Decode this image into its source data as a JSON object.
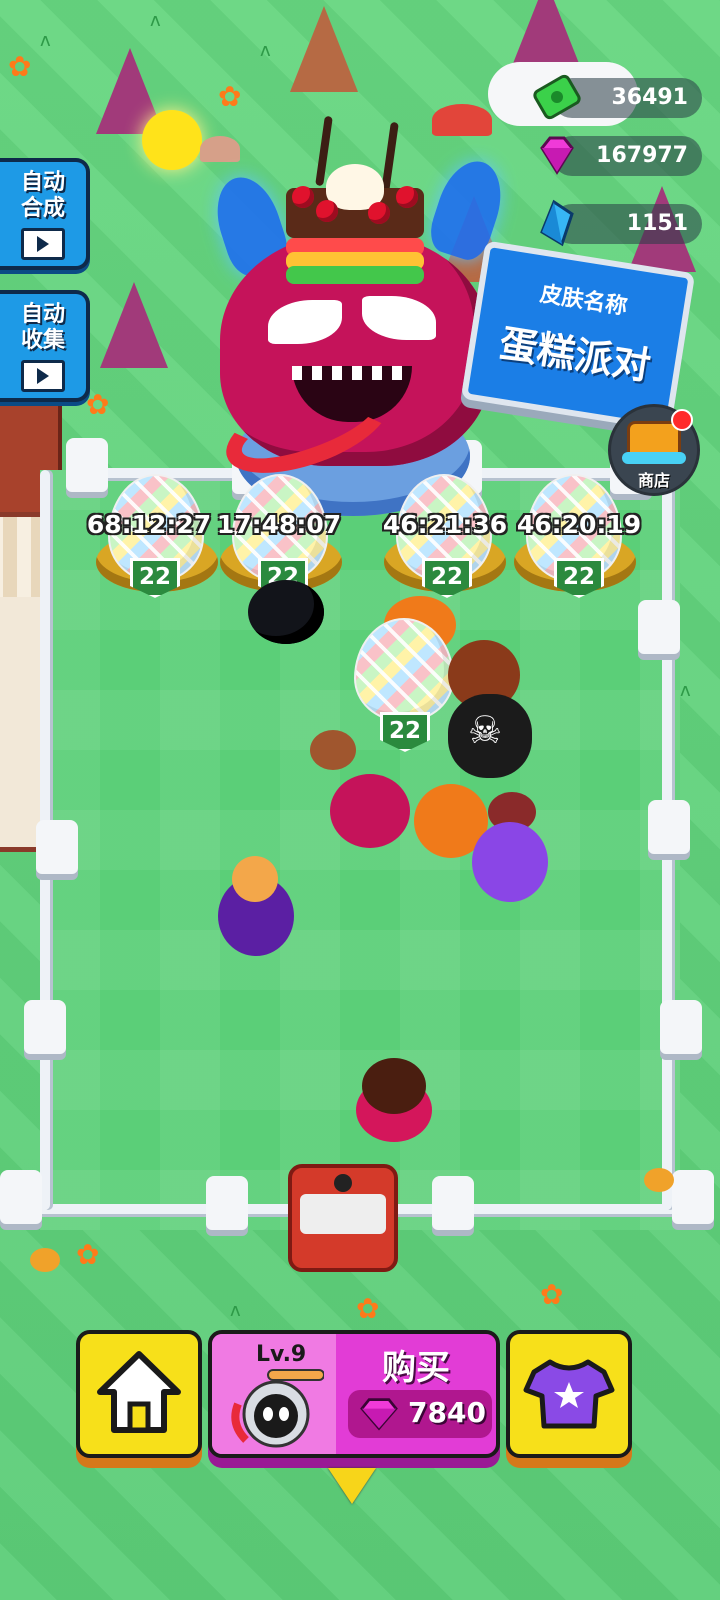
{
  "side_buttons": [
    {
      "label_line1": "自动",
      "label_line2": "合成",
      "icon": "video-icon"
    },
    {
      "label_line1": "自动",
      "label_line2": "收集",
      "icon": "video-icon"
    }
  ],
  "currencies": {
    "cash": {
      "value": "36491",
      "icon": "cash-icon",
      "color": "#3bd14a"
    },
    "gems": {
      "value": "167977",
      "icon": "pink-gem-icon",
      "color": "#f03ad8"
    },
    "diamonds": {
      "value": "1151",
      "icon": "blue-crystal-icon",
      "color": "#37b6f5"
    }
  },
  "billboard": {
    "subtitle": "皮肤名称",
    "title": "蛋糕派对"
  },
  "shop": {
    "label": "商店"
  },
  "eggs": [
    {
      "timer": "68:12:27",
      "level": "22"
    },
    {
      "timer": "17:48:07",
      "level": "22"
    },
    {
      "timer": "46:21:36",
      "level": "22"
    },
    {
      "timer": "46:20:19",
      "level": "22"
    }
  ],
  "field_egg": {
    "level": "22"
  },
  "bottom_bar": {
    "buy": {
      "level": "Lv.9",
      "title": "购买",
      "price": "7840"
    }
  }
}
